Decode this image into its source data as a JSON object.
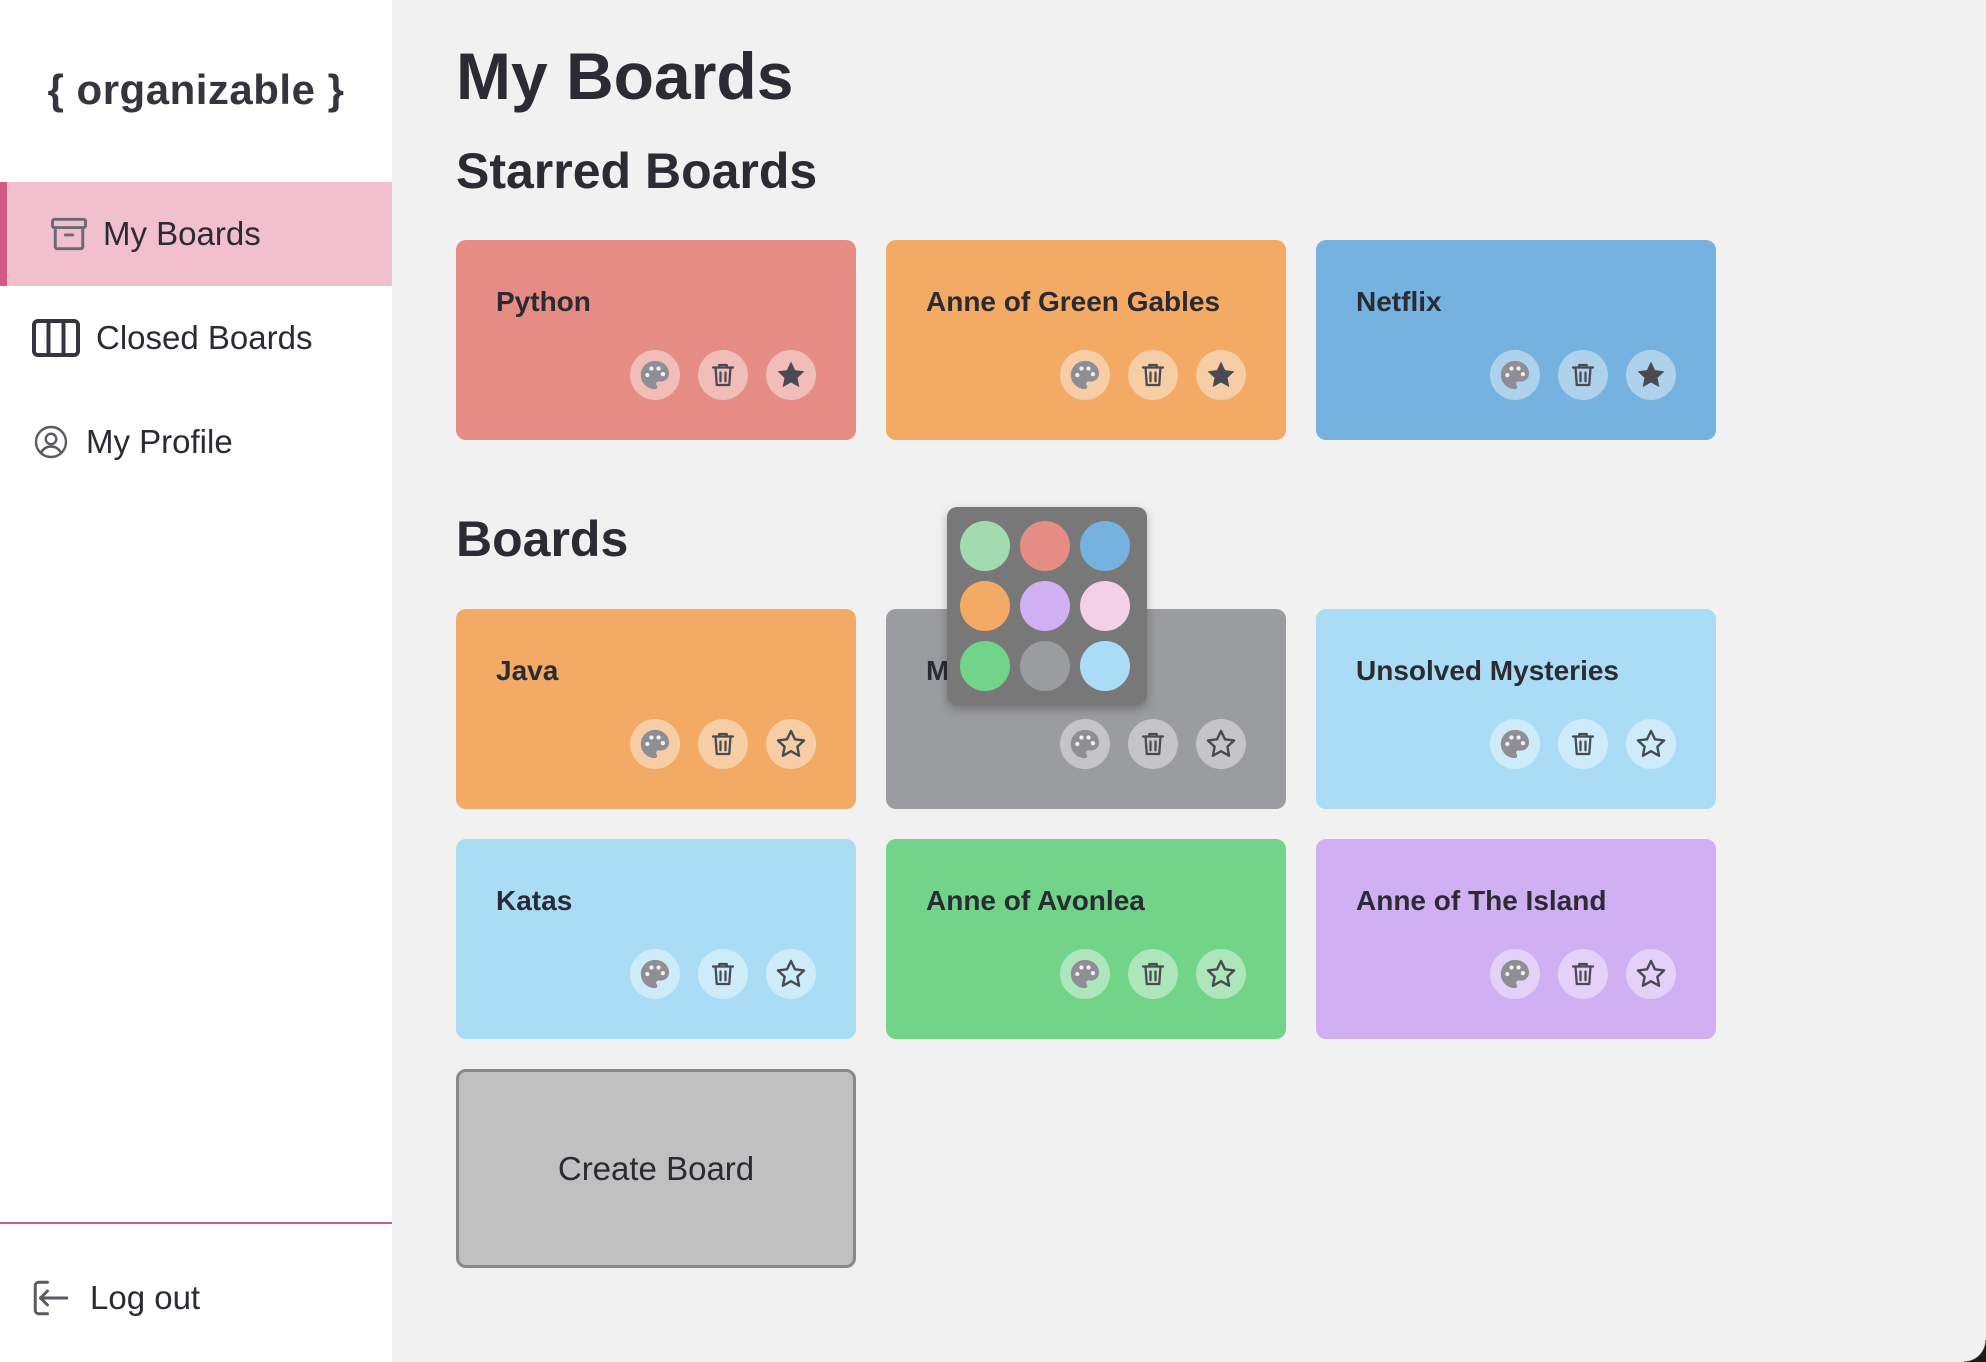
{
  "app": {
    "logo": "{ organizable }"
  },
  "sidebar": {
    "items": [
      {
        "label": "My Boards",
        "icon": "archive-icon",
        "active": true
      },
      {
        "label": "Closed Boards",
        "icon": "columns-icon",
        "active": false
      },
      {
        "label": "My Profile",
        "icon": "user-circle-icon",
        "active": false
      }
    ],
    "logout_label": "Log out"
  },
  "main": {
    "title": "My Boards",
    "starred_title": "Starred Boards",
    "boards_title": "Boards",
    "create_label": "Create Board"
  },
  "starred_boards": [
    {
      "title": "Python",
      "color": "#e58d85",
      "starred": true
    },
    {
      "title": "Anne of Green Gables",
      "color": "#f2aa65",
      "starred": true
    },
    {
      "title": "Netflix",
      "color": "#75b2df",
      "starred": true
    }
  ],
  "boards": [
    {
      "title": "Java",
      "color": "#f2aa65",
      "starred": false
    },
    {
      "title": "Maths",
      "color": "#9b9ca0",
      "starred": false
    },
    {
      "title": "Unsolved Mysteries",
      "color": "#abdcf5",
      "starred": false
    },
    {
      "title": "Katas",
      "color": "#abdcf5",
      "starred": false
    },
    {
      "title": "Anne of Avonlea",
      "color": "#72d488",
      "starred": false
    },
    {
      "title": "Anne of The Island",
      "color": "#d0b0f2",
      "starred": false
    }
  ],
  "color_picker": {
    "colors": [
      "#a2dbb0",
      "#e58d85",
      "#75b2df",
      "#f2aa65",
      "#d0b0f2",
      "#f5cfe6",
      "#72d488",
      "#9b9ca0",
      "#abdcf5"
    ]
  },
  "theme": {
    "accent": "#d05a85",
    "active_bg": "#f1bfce",
    "background": "#f1f1f1"
  }
}
